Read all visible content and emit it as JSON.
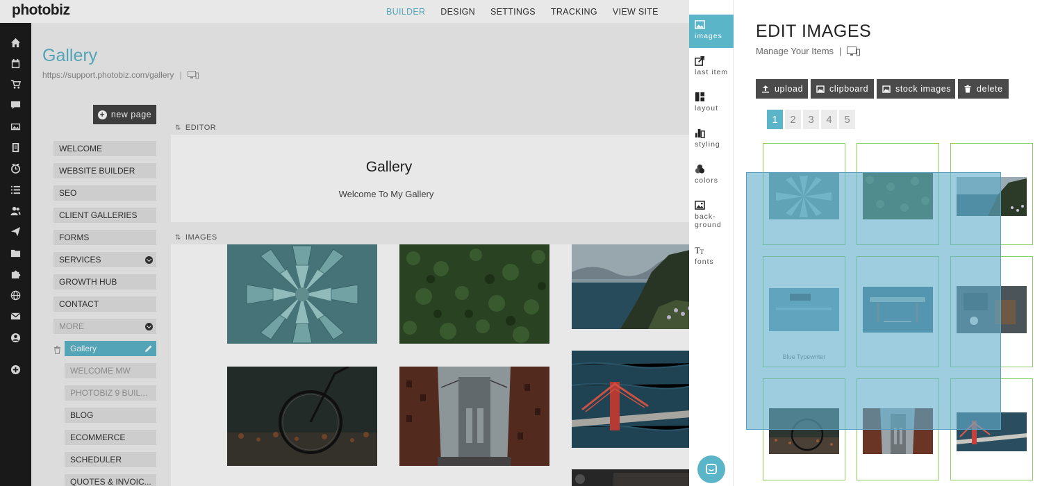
{
  "app": {
    "logo": "photobiz",
    "nav": [
      "BUILDER",
      "DESIGN",
      "SETTINGS",
      "TRACKING",
      "VIEW SITE"
    ],
    "active_nav": "BUILDER"
  },
  "icon_rail": [
    "home-icon",
    "calendar-icon",
    "cart-icon",
    "chat-icon",
    "gallery-icon",
    "book-icon",
    "schedule-icon",
    "list-icon",
    "contacts-icon",
    "send-icon",
    "folder-icon",
    "puzzle-icon",
    "globe-icon",
    "mail-icon",
    "account-icon",
    "add-icon"
  ],
  "page": {
    "title": "Gallery",
    "url": "https://support.photobiz.com/gallery",
    "url_sep": "|"
  },
  "pages_panel": {
    "new_page_label": "new page",
    "items": [
      {
        "label": "WELCOME"
      },
      {
        "label": "WEBSITE BUILDER"
      },
      {
        "label": "SEO"
      },
      {
        "label": "CLIENT GALLERIES"
      },
      {
        "label": "FORMS"
      },
      {
        "label": "SERVICES"
      },
      {
        "label": "GROWTH HUB"
      },
      {
        "label": "CONTACT"
      },
      {
        "label": "MORE"
      },
      {
        "label": "Gallery"
      },
      {
        "label": "WELCOME MW"
      },
      {
        "label": "PHOTOBIZ 9 BUIL..."
      },
      {
        "label": "BLOG"
      },
      {
        "label": "ECOMMERCE"
      },
      {
        "label": "SCHEDULER"
      },
      {
        "label": "QUOTES & INVOIC..."
      }
    ]
  },
  "editor": {
    "editor_label": "EDITOR",
    "heading": "Gallery",
    "subheading": "Welcome To My Gallery",
    "images_label": "IMAGES"
  },
  "tools": [
    {
      "label": "images",
      "icon": "image-icon"
    },
    {
      "label": "last item",
      "icon": "share-icon"
    },
    {
      "label": "layout",
      "icon": "layout-icon"
    },
    {
      "label": "styling",
      "icon": "styling-icon"
    },
    {
      "label": "colors",
      "icon": "colors-icon"
    },
    {
      "label": "back-",
      "label2": "ground",
      "icon": "background-icon"
    },
    {
      "label": "fonts",
      "icon": "fonts-icon"
    }
  ],
  "edit_panel": {
    "title": "EDIT IMAGES",
    "subtitle": "Manage Your Items",
    "sep": "|",
    "buttons": [
      {
        "label": "upload",
        "icon": "upload-icon"
      },
      {
        "label": "clipboard",
        "icon": "clipboard-icon"
      },
      {
        "label": "stock images",
        "icon": "stock-images-icon"
      },
      {
        "label": "delete",
        "icon": "trash-icon"
      }
    ],
    "pages": [
      "1",
      "2",
      "3",
      "4",
      "5"
    ],
    "active_page": "1",
    "thumb_captions": {
      "typewriter": "Blue Typewriter"
    }
  },
  "colors": {
    "accent": "#5bb5c9",
    "dark": "#4a4a4a",
    "rail": "#1c1c1c",
    "thumb_border": "#8ccd5e"
  }
}
